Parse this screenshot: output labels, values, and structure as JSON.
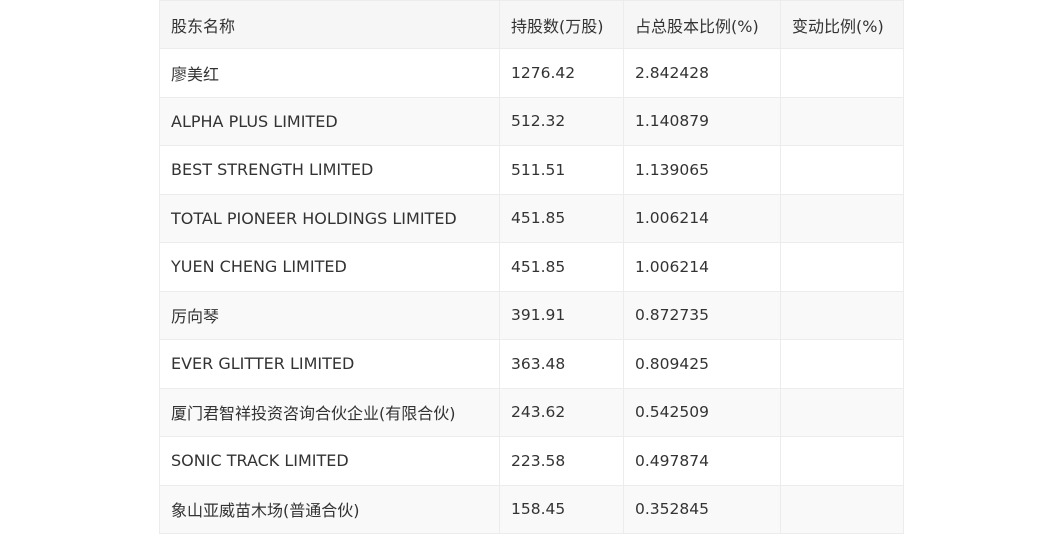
{
  "table": {
    "headers": [
      "股东名称",
      "持股数(万股)",
      "占总股本比例(%)",
      "变动比例(%)"
    ],
    "rows": [
      {
        "name": "廖美红",
        "shares": "1276.42",
        "ratio": "2.842428",
        "change": ""
      },
      {
        "name": "ALPHA PLUS LIMITED",
        "shares": "512.32",
        "ratio": "1.140879",
        "change": ""
      },
      {
        "name": "BEST STRENGTH LIMITED",
        "shares": "511.51",
        "ratio": "1.139065",
        "change": ""
      },
      {
        "name": "TOTAL PIONEER HOLDINGS LIMITED",
        "shares": "451.85",
        "ratio": "1.006214",
        "change": ""
      },
      {
        "name": "YUEN CHENG LIMITED",
        "shares": "451.85",
        "ratio": "1.006214",
        "change": ""
      },
      {
        "name": "厉向琴",
        "shares": "391.91",
        "ratio": "0.872735",
        "change": ""
      },
      {
        "name": "EVER GLITTER LIMITED",
        "shares": "363.48",
        "ratio": "0.809425",
        "change": ""
      },
      {
        "name": "厦门君智祥投资咨询合伙企业(有限合伙)",
        "shares": "243.62",
        "ratio": "0.542509",
        "change": ""
      },
      {
        "name": "SONIC TRACK LIMITED",
        "shares": "223.58",
        "ratio": "0.497874",
        "change": ""
      },
      {
        "name": "象山亚威苗木场(普通合伙)",
        "shares": "158.45",
        "ratio": "0.352845",
        "change": ""
      }
    ]
  }
}
